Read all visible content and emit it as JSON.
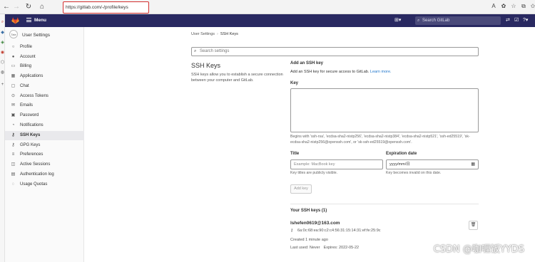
{
  "browser": {
    "url": "https://gitlab.com/-/profile/keys",
    "back_icon": "arrow-left-icon",
    "forward_icon": "arrow-right-icon",
    "reload_icon": "reload-icon",
    "home_icon": "home-icon",
    "toolbar_icons": [
      "A",
      "✿",
      "☆",
      "⧉",
      "✩",
      "⊞",
      "…"
    ]
  },
  "gitlab_header": {
    "menu_label": "Menu",
    "search_placeholder": "Search GitLab",
    "brand_color": "#292961"
  },
  "sidebar": {
    "title": "User Settings",
    "avatar_alt": "Tale",
    "items": [
      {
        "label": "Profile",
        "icon": "○"
      },
      {
        "label": "Account",
        "icon": "●"
      },
      {
        "label": "Billing",
        "icon": "▭"
      },
      {
        "label": "Applications",
        "icon": "▦"
      },
      {
        "label": "Chat",
        "icon": "▢"
      },
      {
        "label": "Access Tokens",
        "icon": "⊙"
      },
      {
        "label": "Emails",
        "icon": "✉"
      },
      {
        "label": "Password",
        "icon": "▣"
      },
      {
        "label": "Notifications",
        "icon": "◔"
      },
      {
        "label": "SSH Keys",
        "icon": "⚷"
      },
      {
        "label": "GPG Keys",
        "icon": "⚷"
      },
      {
        "label": "Preferences",
        "icon": "≡"
      },
      {
        "label": "Active Sessions",
        "icon": "◫"
      },
      {
        "label": "Authentication log",
        "icon": "▤"
      },
      {
        "label": "Usage Quotas",
        "icon": "◌"
      }
    ],
    "active_index": 9
  },
  "breadcrumb": {
    "parent": "User Settings",
    "separator": "›",
    "current": "SSH Keys"
  },
  "search_settings_placeholder": "Search settings",
  "ssh": {
    "heading": "SSH Keys",
    "description": "SSH keys allow you to establish a secure connection between your computer and GitLab.",
    "add_title": "Add an SSH key",
    "add_subtitle": "Add an SSH key for secure access to GitLab.",
    "learn_more": "Learn more.",
    "key_label": "Key",
    "key_help": "Begins with 'ssh-rsa', 'ecdsa-sha2-nistp256', 'ecdsa-sha2-nistp384', 'ecdsa-sha2-nistp521', 'ssh-ed25519', 'sk-ecdsa-sha2-nistp256@openssh.com', or 'sk-ssh-ed25519@openssh.com'.",
    "title_label": "Title",
    "title_placeholder": "Example: MacBook key",
    "title_help": "Key titles are publicly visible.",
    "expiration_label": "Expiration date",
    "expiration_placeholder": "yyyy/mm/日",
    "expiration_help": "Key becomes invalid on this date.",
    "add_button": "Add key",
    "your_keys_title": "Your SSH keys (1)",
    "key": {
      "email": "lshefen0619@163.com",
      "fingerprint": "6a:0c:68:ea:90:c2:c4:56:31:15:14:31:ef:fe:25:9c",
      "created": "Created 1 minute ago",
      "last_used": "Last used: Never",
      "expires": "Expires: 2022-05-22"
    }
  },
  "watermark": "CSDN @咖喱饭YYDS"
}
